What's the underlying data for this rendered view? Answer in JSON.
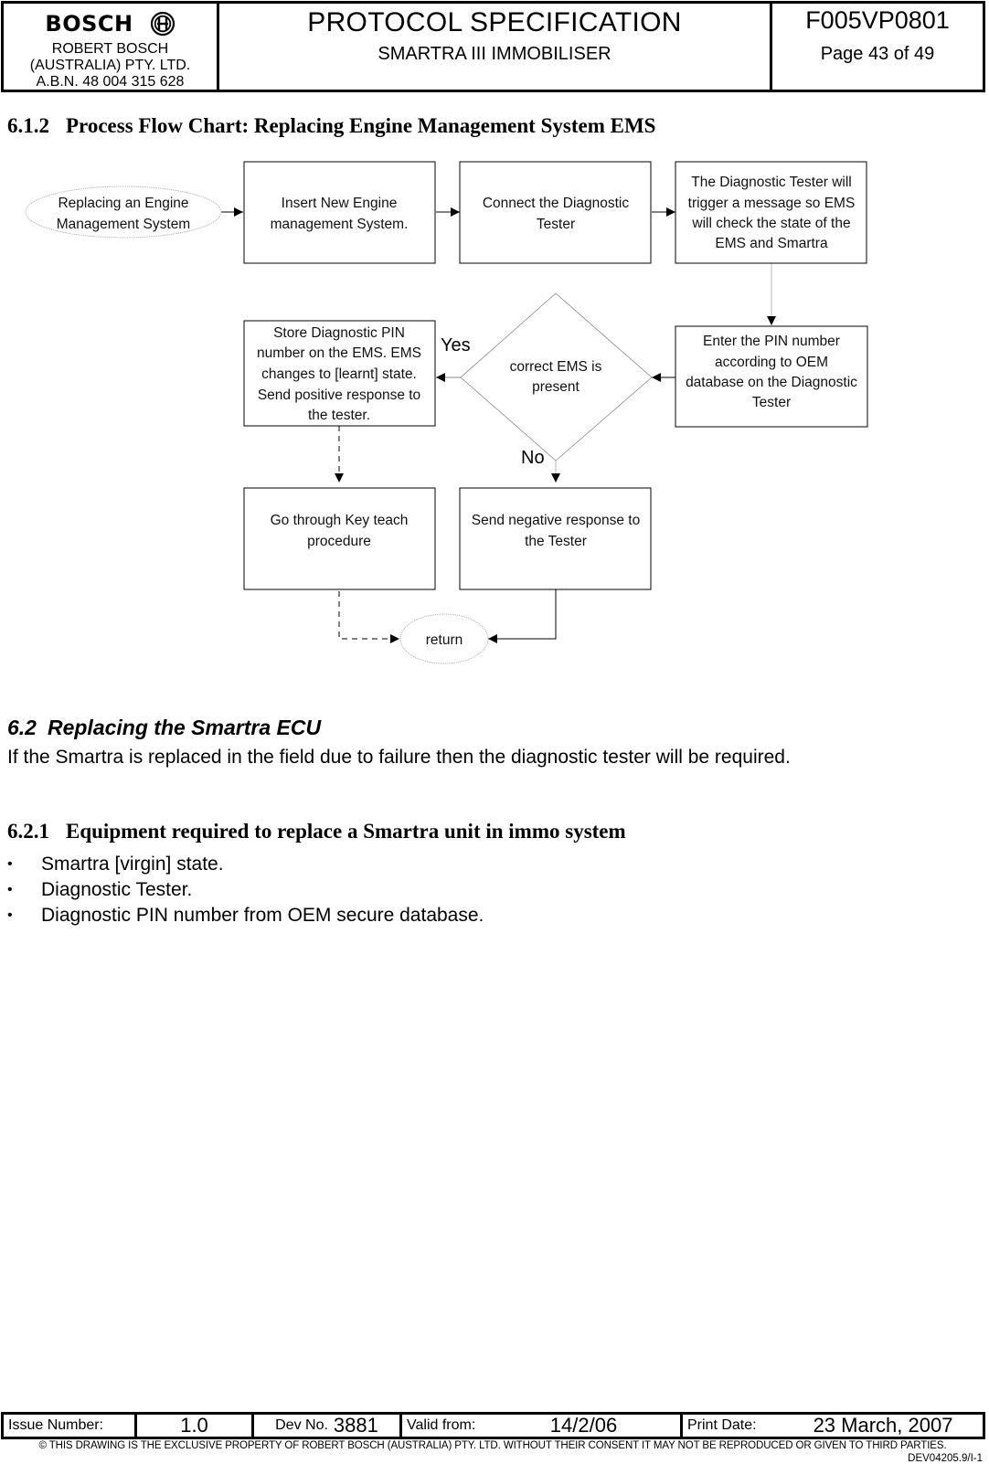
{
  "header": {
    "brand": "BOSCH",
    "brand_icon": "bosch-armature-icon",
    "company_lines": [
      "ROBERT BOSCH",
      "(AUSTRALIA) PTY. LTD.",
      "A.B.N. 48 004 315 628"
    ],
    "doc_title": "PROTOCOL SPECIFICATION",
    "doc_subtitle": "SMARTRA III IMMOBILISER",
    "doc_number": "F005VP0801",
    "page": "Page 43 of 49"
  },
  "section_612": {
    "number": "6.1.2",
    "title": "Process Flow Chart: Replacing Engine Management System EMS"
  },
  "flowchart": {
    "nodes": {
      "start": [
        "Replacing an Engine",
        "Management System"
      ],
      "insert": [
        "Insert New Engine",
        "management System."
      ],
      "connect": [
        "Connect the Diagnostic",
        "Tester"
      ],
      "trigger": [
        "The Diagnostic Tester will",
        "trigger a message so EMS",
        "will check the state of the",
        "EMS and Smartra"
      ],
      "enter_pin": [
        "Enter the PIN number",
        "according to OEM",
        "database on the Diagnostic",
        "Tester"
      ],
      "decision": [
        "correct EMS is",
        "present"
      ],
      "store_pin": [
        "Store Diagnostic PIN",
        "number on the EMS.   EMS",
        "changes  to [learnt] state.",
        "Send positive response to",
        "the tester."
      ],
      "key_teach": [
        "Go through Key teach",
        "procedure"
      ],
      "negative": [
        "Send negative response to",
        "the Tester"
      ],
      "return": [
        "return"
      ]
    },
    "labels": {
      "yes": "Yes",
      "no": "No"
    }
  },
  "section_62": {
    "number": "6.2",
    "title": "Replacing the Smartra ECU",
    "body": "If the Smartra is replaced in the field due to failure then the diagnostic tester will be required."
  },
  "section_621": {
    "number": "6.2.1",
    "title": "Equipment required to replace a Smartra unit in immo system",
    "bullet": "•",
    "items": [
      "Smartra [virgin] state.",
      "Diagnostic Tester.",
      "Diagnostic PIN number from OEM secure database."
    ]
  },
  "footer": {
    "issue_label": "Issue Number:",
    "issue_value": "1.0",
    "dev_label": "Dev No.",
    "dev_value": "3881",
    "valid_label": "Valid from:",
    "valid_value": "14/2/06",
    "print_label": "Print Date:",
    "print_value": "23 March, 2007",
    "copyright": "© THIS DRAWING IS THE EXCLUSIVE PROPERTY OF ROBERT  BOSCH (AUSTRALIA)  PTY. LTD.  WITHOUT THEIR CONSENT IT MAY NOT BE REPRODUCED OR GIVEN TO THIRD PARTIES.",
    "form_number": "DEV04205.9/I-1"
  }
}
